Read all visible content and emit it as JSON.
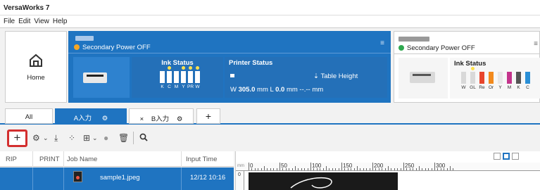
{
  "app": {
    "title": "VersaWorks 7"
  },
  "menu": [
    "File",
    "Edit",
    "View",
    "Help"
  ],
  "home": {
    "label": "Home",
    "icon": "home-icon"
  },
  "printer1": {
    "power_status": "Secondary Power OFF",
    "power_color": "#f5a623",
    "ink_status_title": "Ink Status",
    "inks": [
      {
        "label": "K",
        "drop": ""
      },
      {
        "label": "C",
        "drop": "#ffe14d"
      },
      {
        "label": "M",
        "drop": ""
      },
      {
        "label": "Y",
        "drop": "#ffe14d"
      },
      {
        "label": "PR",
        "drop": "#ffe14d"
      },
      {
        "label": "W",
        "drop": "#ffe14d"
      }
    ],
    "printer_status_title": "Printer Status",
    "table_height_label": "Table Height",
    "width_prefix": "W",
    "width_value": "305.0",
    "length_prefix": "L",
    "length_value": "0.0",
    "unit": "mm",
    "other_dim": "--.-- mm"
  },
  "printer2": {
    "power_status": "Secondary Power OFF",
    "power_color": "#2fa84f",
    "ink_status_title": "Ink Status",
    "inks": [
      {
        "label": "W",
        "color": "#d9d9d9",
        "drop": ""
      },
      {
        "label": "GL",
        "color": "#d9d9d9",
        "drop": "#ffe14d"
      },
      {
        "label": "Re",
        "color": "#e8452c",
        "drop": ""
      },
      {
        "label": "Or",
        "color": "#f28a1d",
        "drop": ""
      },
      {
        "label": "Y",
        "color": "#e8e8e8",
        "drop": ""
      },
      {
        "label": "M",
        "color": "#c4348c",
        "drop": ""
      },
      {
        "label": "K",
        "color": "#555555",
        "drop": ""
      },
      {
        "label": "C",
        "color": "#2a8fd6",
        "drop": ""
      }
    ]
  },
  "tabs": {
    "all": "All",
    "a": "A入力",
    "b": "B入力",
    "close_symbol": "×",
    "add_symbol": "+"
  },
  "toolbar": {
    "add": "+"
  },
  "columns": {
    "rip": "RIP",
    "print": "PRINT",
    "job_name": "Job Name",
    "input_time": "Input Time"
  },
  "jobs": [
    {
      "name": "sample1.jpeg",
      "input_time": "12/12 10:16"
    }
  ],
  "preview": {
    "unit_label": "mm",
    "ruler_labels": [
      "0",
      "50",
      "100",
      "150",
      "200",
      "250",
      "300"
    ],
    "vruler_label": "0"
  }
}
